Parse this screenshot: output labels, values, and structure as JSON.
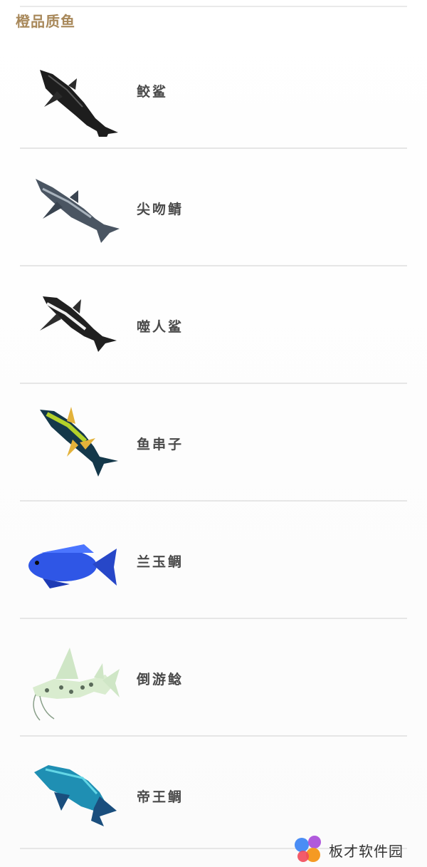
{
  "section": {
    "title": "橙品质鱼"
  },
  "fish": [
    {
      "name": "鲛鲨",
      "image": "dark-shark"
    },
    {
      "name": "尖吻鲭",
      "image": "blue-shark"
    },
    {
      "name": "噬人鲨",
      "image": "white-shark"
    },
    {
      "name": "鱼串子",
      "image": "tuna"
    },
    {
      "name": "兰玉鲷",
      "image": "blue-cichlid"
    },
    {
      "name": "倒游鲶",
      "image": "spotted-catfish"
    },
    {
      "name": "帝王鲷",
      "image": "emperor-cichlid"
    }
  ],
  "watermark": {
    "text": "板才软件园"
  }
}
